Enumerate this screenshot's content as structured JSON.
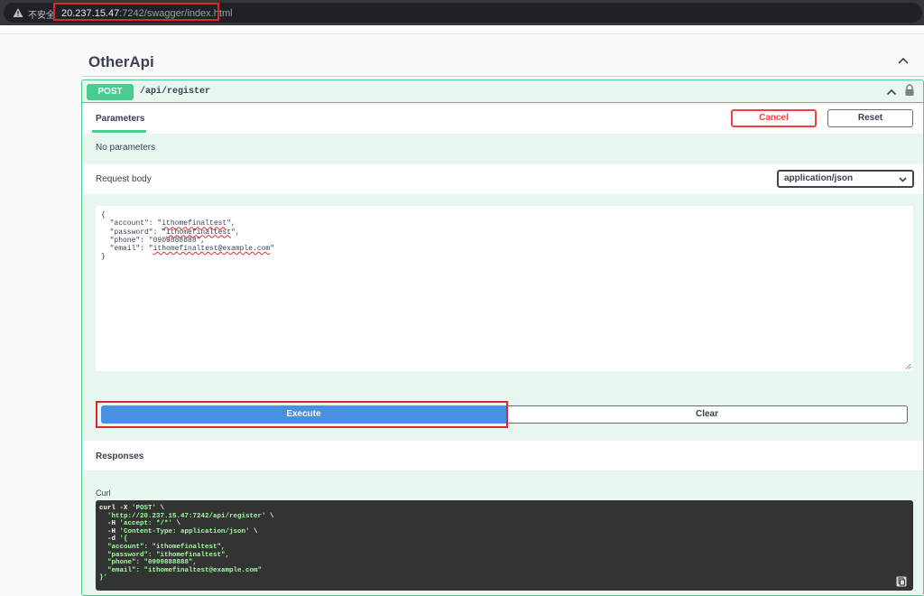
{
  "browser": {
    "insecure_label": "不安全",
    "url_host": "20.237.15.47",
    "url_rest": ":7242/swagger/index.html"
  },
  "section": {
    "title": "OtherApi"
  },
  "operation": {
    "method": "POST",
    "path": "/api/register",
    "parameters_tab": "Parameters",
    "cancel_label": "Cancel",
    "reset_label": "Reset",
    "no_params": "No parameters",
    "request_body_label": "Request body",
    "content_type": "application/json",
    "body_lines": [
      "{",
      "  \"account\": \"",
      "ithomefinaltest",
      "\",",
      "  \"password\": \"",
      "ithomefinaltest",
      "\",",
      "  \"phone\": \"0909888888\",",
      "  \"email\": \"",
      "ithomefinaltest@example.com",
      "\"",
      "}"
    ],
    "execute_label": "Execute",
    "clear_label": "Clear",
    "responses_label": "Responses",
    "curl_label": "Curl",
    "curl_lines": [
      "curl -X ",
      "'POST'",
      " \\",
      "  ",
      "'http://20.237.15.47:7242/api/register'",
      " \\",
      "  -H ",
      "'accept: */*'",
      " \\",
      "  -H ",
      "'Content-Type: application/json'",
      " \\",
      "  -d ",
      "'{",
      "  \"account\": \"ithomefinaltest\",",
      "  \"password\": \"ithomefinaltest\",",
      "  \"phone\": \"0909888888\",",
      "  \"email\": \"ithomefinaltest@example.com\"",
      "}'"
    ]
  },
  "colors": {
    "post_green": "#49cc90",
    "execute_blue": "#4990e2",
    "cancel_red": "#f93e3e",
    "highlight_red": "#e3242b"
  }
}
